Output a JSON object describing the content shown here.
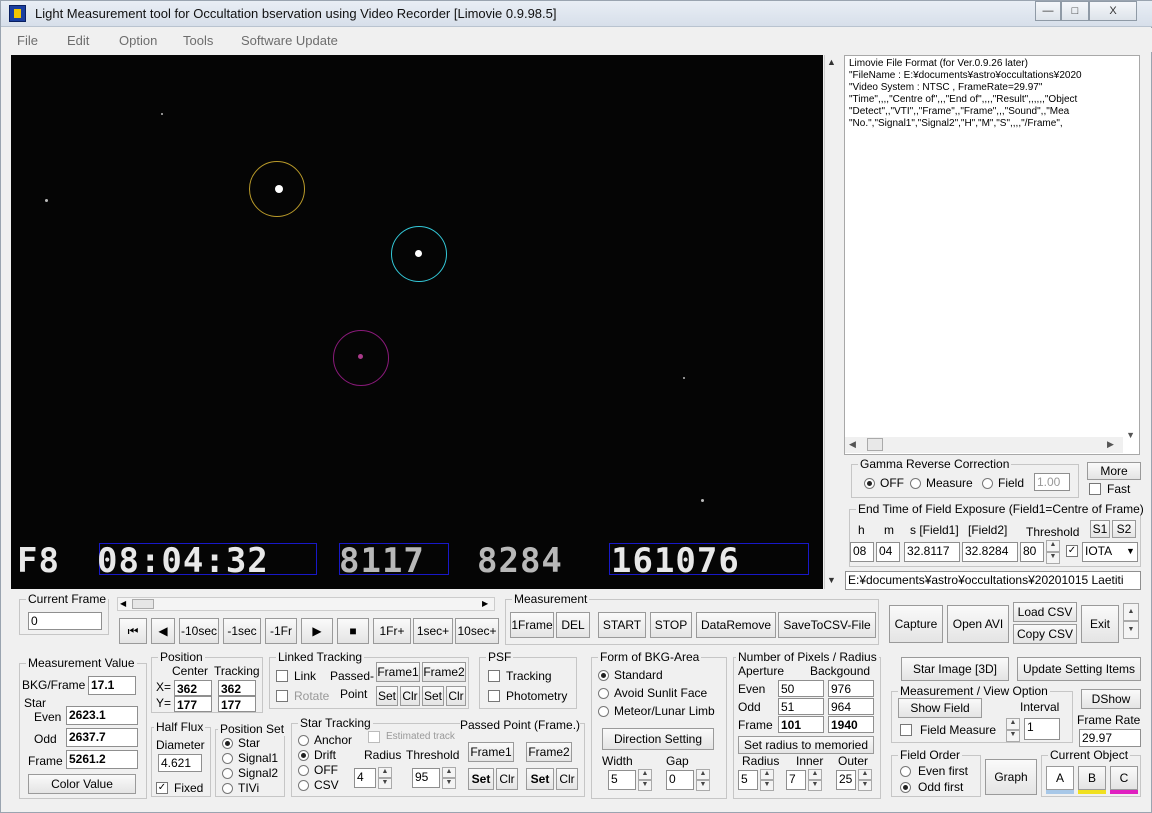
{
  "window": {
    "title": "Light Measurement tool for Occultation bservation using Video Recorder [Limovie 0.9.98.5]",
    "minimize": "—",
    "maximize": "□",
    "close": "X"
  },
  "menu": [
    "File",
    "Edit",
    "Option",
    "Tools",
    "Software Update"
  ],
  "video": {
    "ts_field": "F8",
    "ts_time": "08:04:32",
    "ts_a": "8117",
    "ts_b": "8284",
    "ts_c": "161076"
  },
  "log": {
    "lines": [
      "Limovie File Format (for Ver.0.9.26 later)",
      "\"FileName : E:¥documents¥astro¥occultations¥2020",
      "\"Video System : NTSC , FrameRate=29.97\"",
      "\"Time\",,,,\"Centre of\",,,\"End of\",,,,\"Result\",,,,,,\"Object",
      "\"Detect\",,\"VTI\",,\"Frame\",,\"Frame\",,,\"Sound\",,\"Mea",
      "\"No.\",\"Signal1\",\"Signal2\",\"H\",\"M\",\"S\",,,,\"/Frame\","
    ]
  },
  "gamma": {
    "title": "Gamma Reverse Correction",
    "opt_off": "OFF",
    "opt_measure": "Measure",
    "opt_field": "Field",
    "value": "1.00",
    "more": "More",
    "fast": "Fast"
  },
  "endtime": {
    "title": "End Time of Field Exposure (Field1=Centre of Frame)",
    "h": "h",
    "m": "m",
    "s": "s [Field1]",
    "f2": "[Field2]",
    "threshold": "Threshold",
    "s1": "S1",
    "s2": "S2",
    "h_val": "08",
    "m_val": "04",
    "s_val": "32.8117",
    "f2_val": "32.8284",
    "thr_val": "80",
    "combo": "IOTA"
  },
  "path": "E:¥documents¥astro¥occultations¥20201015 Laetiti",
  "current_frame": {
    "title": "Current Frame",
    "value": "0"
  },
  "playback": {
    "first": "⏮",
    "prev": "◀",
    "m10": "-10sec",
    "m1s": "-1sec",
    "m1f": "-1Fr",
    "play": "▶",
    "stop": "■",
    "p1f": "1Fr+",
    "p1s": "1sec+",
    "p10": "10sec+"
  },
  "measurement": {
    "title": "Measurement",
    "frame1": "1Frame",
    "del": "DEL",
    "start": "START",
    "stop": "STOP",
    "dataremove": "DataRemove",
    "savecsv": "SaveToCSV-File"
  },
  "rightbtns": {
    "capture": "Capture",
    "openavi": "Open AVI",
    "loadcsv": "Load CSV",
    "copycsv": "Copy CSV",
    "exit": "Exit",
    "starimage": "Star Image [3D]",
    "update": "Update Setting Items"
  },
  "measval": {
    "title": "Measurement Value",
    "bkg_label": "BKG/Frame",
    "bkg": "17.1",
    "star": "Star",
    "even_label": "Even",
    "even": "2623.1",
    "odd_label": "Odd",
    "odd": "2637.7",
    "frame_label": "Frame",
    "frame": "5261.2",
    "colorvalue": "Color Value"
  },
  "position": {
    "title": "Position",
    "center": "Center",
    "tracking": "Tracking",
    "x_label": "X=",
    "y_label": "Y=",
    "x": "362",
    "y": "177",
    "tx": "362",
    "ty": "177"
  },
  "halfflux": {
    "title": "Half Flux",
    "diameter": "Diameter",
    "value": "4.621",
    "fixed": "Fixed"
  },
  "posset": {
    "title": "Position Set",
    "star": "Star",
    "signal1": "Signal1",
    "signal2": "Signal2",
    "tivi": "TIVi"
  },
  "linked": {
    "title": "Linked Tracking",
    "link": "Link",
    "rotate": "Rotate",
    "passed": "Passed-",
    "point": "Point",
    "frame1": "Frame1",
    "frame2": "Frame2",
    "set": "Set",
    "clr": "Clr"
  },
  "psf": {
    "title": "PSF",
    "tracking": "Tracking",
    "photometry": "Photometry"
  },
  "startrack": {
    "title": "Star Tracking",
    "anchor": "Anchor",
    "drift": "Drift",
    "off": "OFF",
    "csv": "CSV",
    "estimated": "Estimated track",
    "passed": "Passed Point (Frame.)",
    "radius": "Radius",
    "threshold": "Threshold",
    "radius_val": "4",
    "threshold_val": "95",
    "frame1": "Frame1",
    "frame2": "Frame2",
    "set": "Set",
    "clr": "Clr"
  },
  "bkgarea": {
    "title": "Form of BKG-Area",
    "standard": "Standard",
    "avoid": "Avoid Sunlit Face",
    "meteor": "Meteor/Lunar Limb",
    "direction": "Direction Setting",
    "width": "Width",
    "gap": "Gap",
    "width_val": "5",
    "gap_val": "0"
  },
  "pixels": {
    "title": "Number of Pixels / Radius",
    "aperture": "Aperture",
    "background": "Backgound",
    "even": "Even",
    "odd": "Odd",
    "frame": "Frame",
    "ap_even": "50",
    "ap_odd": "51",
    "ap_frame": "101",
    "bg_even": "976",
    "bg_odd": "964",
    "bg_frame": "1940",
    "setradius": "Set  radius to memoried",
    "radius": "Radius",
    "inner": "Inner",
    "outer": "Outer",
    "radius_val": "5",
    "inner_val": "7",
    "outer_val": "25"
  },
  "measview": {
    "title": "Measurement / View Option",
    "showfield": "Show Field",
    "interval": "Interval",
    "interval_val": "1",
    "fieldmeasure": "Field Measure",
    "dshow": "DShow",
    "framerate": "Frame Rate",
    "framerate_val": "29.97"
  },
  "fieldorder": {
    "title": "Field Order",
    "even": "Even first",
    "odd": "Odd first",
    "graph": "Graph"
  },
  "curobj": {
    "title": "Current Object",
    "a": "A",
    "b": "B",
    "c": "C"
  }
}
